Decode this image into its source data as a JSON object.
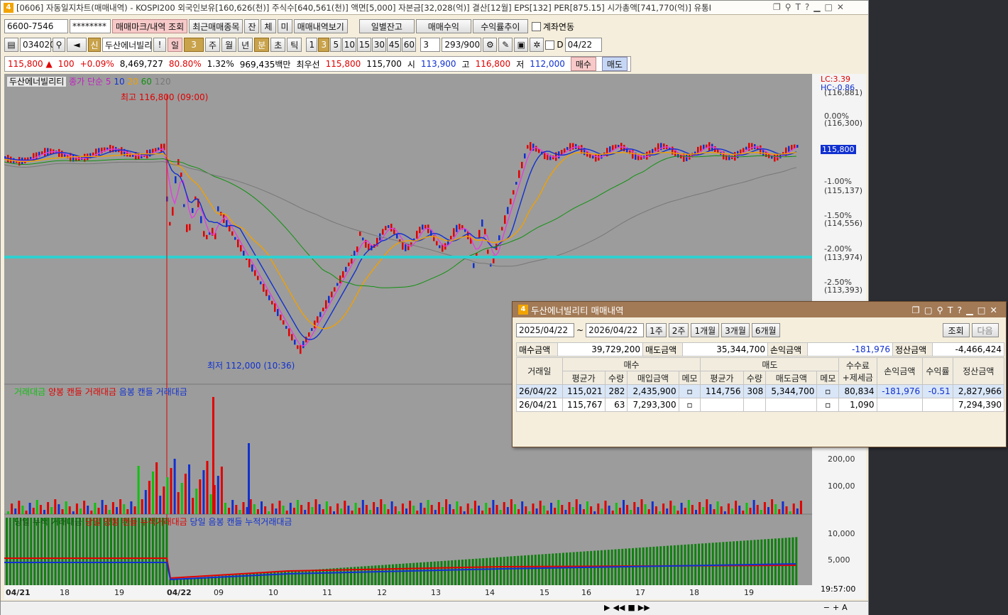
{
  "title": "[0606] 자동일지차트(매매내역) - KOSPI200 외국인보유[160,626(천)] 주식수[640,561(천)] 액면[5,000] 자본금[32,028(억)] 결산[12월] EPS[132] PER[875.15] 시가총액[741,770(억)] 유통I",
  "toolbar1": {
    "account": "6600-7546",
    "password": "********",
    "btn_mark": "매매마크/내역 조회",
    "btn_recent": "최근매매종목",
    "btn_jan": "잔",
    "btn_che": "체",
    "btn_mi": "미",
    "btn_history": "매매내역보기",
    "btn_daily": "일별잔고",
    "btn_profit": "매매수익",
    "btn_trend": "수익률추이",
    "chk_link": "계좌연동"
  },
  "toolbar2": {
    "code": "034020",
    "credit": "신",
    "name": "두산에너빌리",
    "warn": "!",
    "period_day": "일",
    "period_num": "3",
    "p_week": "주",
    "p_month": "월",
    "p_year": "년",
    "p_min": "분",
    "p_sec": "초",
    "p_tick": "틱",
    "intervals": [
      "1",
      "3",
      "5",
      "10",
      "15",
      "30",
      "45",
      "60"
    ],
    "sel_interval": "3",
    "count": "3",
    "range": "293",
    "range_total": "/900",
    "date_chk": "D",
    "date": "04/22"
  },
  "toolbar3": {
    "price": "115,800",
    "arrow": "▲",
    "change": "100",
    "rate": "+0.09%",
    "volume": "8,469,727",
    "ratio": "80.80%",
    "ratio2": "1.32%",
    "amount": "969,435백만",
    "best": "최우선",
    "best_price": "115,800",
    "best_price2": "115,700",
    "open_lbl": "시",
    "open": "113,900",
    "high_lbl": "고",
    "high": "116,800",
    "low_lbl": "저",
    "low": "112,000",
    "buy": "매수",
    "sell": "매도"
  },
  "chart": {
    "name": "두산에너빌리티",
    "ma_label": "종가 단순",
    "ma": [
      "5",
      "10",
      "20",
      "60",
      "120"
    ],
    "high_note": "최고 116,800 (09:00)",
    "low_note": "최저 112,000 (10:36)",
    "lc": "LC:3.39",
    "hc": "HC:-0.86",
    "price_ticks": [
      "(116,881)",
      "0.00%",
      "(116,300)",
      "-1.00%",
      "(115,137)",
      "-1.50%",
      "(114,556)",
      "-2.00%",
      "(113,974)",
      "-2.50%",
      "(113,393)"
    ],
    "price_tag": "115,800",
    "vol_legend": [
      "거래대금",
      "양봉 캔들 거래대금",
      "음봉 캔들 거래대금"
    ],
    "vol_ticks": [
      "200,00",
      "100,00"
    ],
    "cum_legend": [
      "당일 누적 거래대금",
      "당일 양봉 캔들 누적거래대금",
      "당일 음봉 캔들 누적거래대금"
    ],
    "cum_ticks": [
      "10,000",
      "5,000"
    ],
    "xlabels": [
      "04/21",
      "18",
      "19",
      "04/22",
      "09",
      "10",
      "11",
      "12",
      "13",
      "14",
      "15",
      "16",
      "17",
      "18",
      "19"
    ],
    "time": "19:57:00"
  },
  "popup": {
    "title": "두산에너빌리티 매매내역",
    "from": "2025/04/22",
    "to": "2026/04/22",
    "periods": [
      "1주",
      "2주",
      "1개월",
      "3개월",
      "6개월"
    ],
    "query": "조회",
    "next": "다음",
    "summary": {
      "buy_lbl": "매수금액",
      "buy": "39,729,200",
      "sell_lbl": "매도금액",
      "sell": "35,344,700",
      "pl_lbl": "손익금액",
      "pl": "-181,976",
      "settle_lbl": "정산금액",
      "settle": "-4,466,424"
    },
    "head": {
      "date": "거래일",
      "buy": "매수",
      "sell": "매도",
      "fee": "수수료",
      "fee2": "+제세금",
      "pl": "손익금액",
      "rate": "수익률",
      "settle": "정산금액",
      "avg": "평균가",
      "qty": "수량",
      "buyamt": "매입금액",
      "memo": "메모",
      "sellamt": "매도금액"
    },
    "rows": [
      {
        "date": "26/04/22",
        "bavg": "115,021",
        "bqty": "282",
        "bamt": "2,435,900",
        "savg": "114,756",
        "sqty": "308",
        "samt": "5,344,700",
        "fee": "80,834",
        "pl": "-181,976",
        "rate": "-0.51",
        "settle": "2,827,966"
      },
      {
        "date": "26/04/21",
        "bavg": "115,767",
        "bqty": "63",
        "bamt": "7,293,300",
        "savg": "",
        "sqty": "",
        "samt": "",
        "fee": "1,090",
        "pl": "",
        "rate": "",
        "settle": "7,294,390"
      }
    ]
  },
  "colors": {
    "up": "#e00000",
    "down": "#1030d0",
    "ma5": "#e040e0",
    "ma10": "#1030d0",
    "ma20": "#f0a000",
    "ma60": "#109010",
    "ma120": "#777777",
    "hline": "#30d0d0"
  }
}
